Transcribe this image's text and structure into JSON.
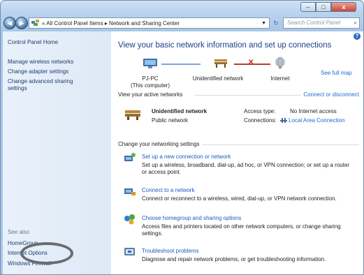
{
  "window": {
    "caption_buttons": [
      "–",
      "□",
      "x"
    ]
  },
  "toolbar": {
    "back_symbol": "◀",
    "forward_symbol": "▶",
    "breadcrumb": "« All Control Panel Items ▸ Network and Sharing Center",
    "refresh_symbol": "↻",
    "search_placeholder": "Search Control Panel",
    "search_symbol": "⌕"
  },
  "sidebar": {
    "title": "Control Panel Home",
    "links": [
      "Manage wireless networks",
      "Change adapter settings",
      "Change advanced sharing settings"
    ],
    "see_also": "See also",
    "see_also_links": [
      "HomeGroup",
      "Internet Options",
      "Windows Firewall"
    ]
  },
  "main": {
    "help_symbol": "?",
    "heading": "View your basic network information and set up connections",
    "see_full_map": "See full map",
    "map": {
      "computer_name": "PJ-PC",
      "computer_note": "(This computer)",
      "middle": "Unidentified network",
      "right": "Internet",
      "status_symbol": "✕"
    },
    "active_networks_label": "View your active networks",
    "connect_disconnect": "Connect or disconnect",
    "network": {
      "name": "Unidentified network",
      "type": "Public network",
      "access_type_label": "Access type:",
      "access_type_value": "No Internet access",
      "connections_label": "Connections:",
      "connections_value": "Local Area Connection"
    },
    "change_settings_label": "Change your networking settings",
    "tasks": [
      {
        "title": "Set up a new connection or network",
        "desc": "Set up a wireless, broadband, dial-up, ad hoc, or VPN connection; or set up a router or access point."
      },
      {
        "title": "Connect to a network",
        "desc": "Connect or reconnect to a wireless, wired, dial-up, or VPN network connection."
      },
      {
        "title": "Choose homegroup and sharing options",
        "desc": "Access files and printers located on other network computers, or change sharing settings."
      },
      {
        "title": "Troubleshoot problems",
        "desc": "Diagnose and repair network problems, or get troubleshooting information."
      }
    ]
  },
  "colors": {
    "heading": "#1c3f8a",
    "link": "#1c6bd0",
    "sidebar_link": "#1f3c6b",
    "highlight_circle": "#6b6b6b"
  }
}
